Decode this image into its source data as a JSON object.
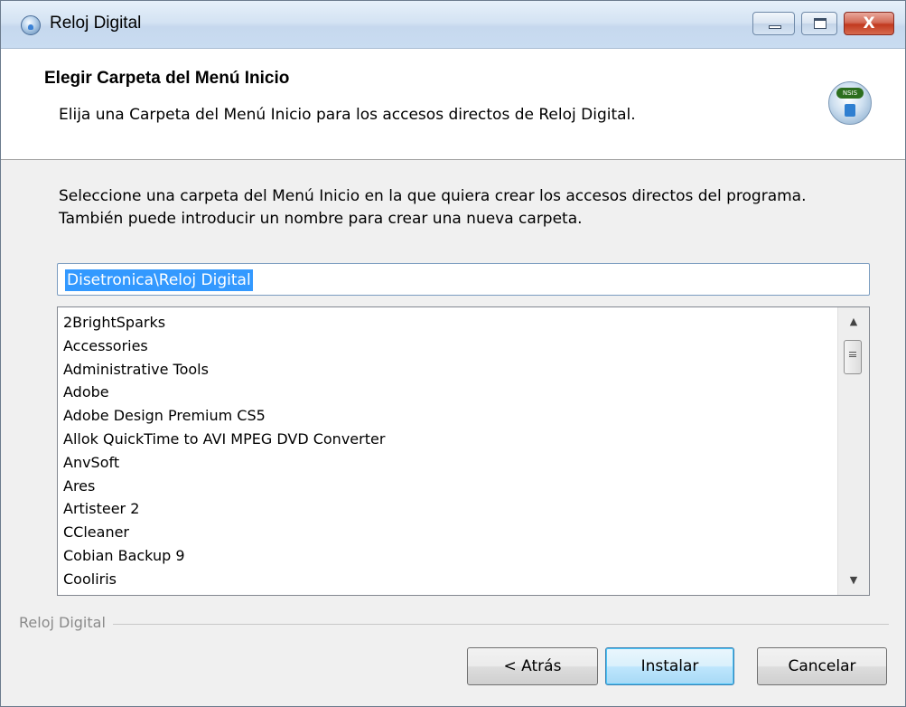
{
  "window": {
    "title": "Reloj Digital",
    "controls": {
      "minimize": "minimize",
      "maximize": "maximize",
      "close": "X"
    }
  },
  "header": {
    "title": "Elegir Carpeta del Menú Inicio",
    "subtitle": "Elija una Carpeta del Menú Inicio para los accesos directos de Reloj Digital.",
    "icon": "nsis-installer-icon",
    "icon_badge": "NSIS"
  },
  "body": {
    "instructions": "Seleccione una carpeta del Menú Inicio en la que quiera crear los accesos directos del programa. También puede introducir un nombre para crear una nueva carpeta.",
    "folder_input_value": "Disetronica\\Reloj Digital",
    "folder_list": [
      "2BrightSparks",
      "Accessories",
      "Administrative Tools",
      "Adobe",
      "Adobe Design Premium CS5",
      "Allok QuickTime to AVI MPEG DVD Converter",
      "AnvSoft",
      "Ares",
      "Artisteer 2",
      "CCleaner",
      "Cobian Backup 9",
      "Cooliris"
    ]
  },
  "footer": {
    "branding": "Reloj Digital",
    "buttons": {
      "back": "< Atrás",
      "install": "Instalar",
      "cancel": "Cancelar"
    }
  },
  "colors": {
    "selection": "#3399ff",
    "close_button": "#c2391f",
    "default_button_border": "#3c7fb1"
  }
}
